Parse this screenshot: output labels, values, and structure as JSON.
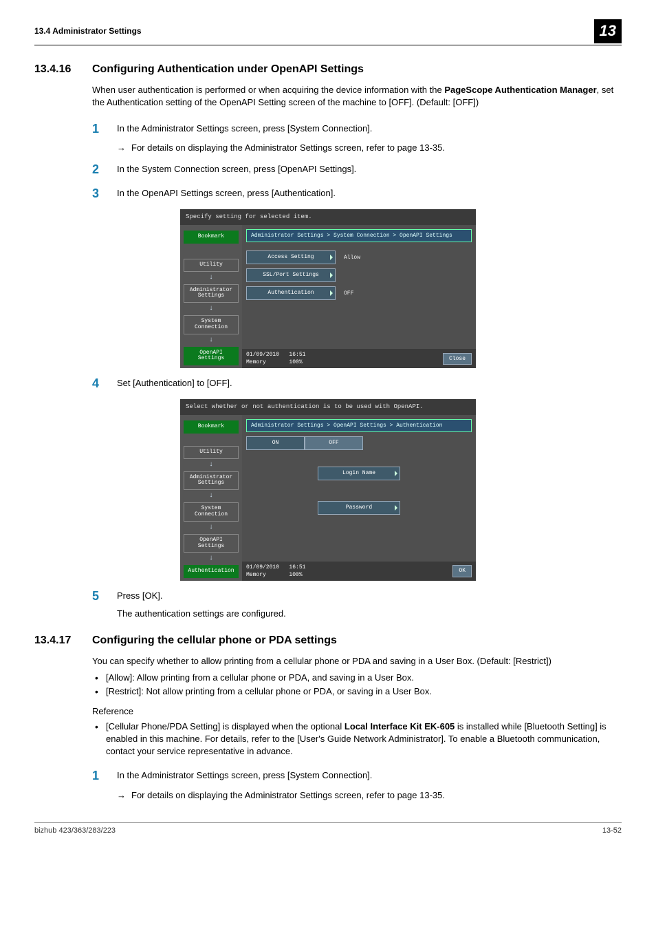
{
  "header": {
    "left": "13.4    Administrator Settings",
    "right": "13"
  },
  "sec1": {
    "num": "13.4.16",
    "title": "Configuring Authentication under OpenAPI Settings",
    "intro_a": "When user authentication is performed or when acquiring the device information with the ",
    "intro_bold": "PageScope Authentication Manager",
    "intro_b": ", set the Authentication setting of the OpenAPI Setting screen of the machine to [OFF]. (Default: [OFF])",
    "steps": {
      "s1": "In the Administrator Settings screen, press [System Connection].",
      "s1_sub": "For details on displaying the Administrator Settings screen, refer to page 13-35.",
      "s2": "In the System Connection screen, press [OpenAPI Settings].",
      "s3": "In the OpenAPI Settings screen, press [Authentication].",
      "s4": "Set [Authentication] to [OFF].",
      "s5": "Press [OK].",
      "s5_after": "The authentication settings are configured."
    }
  },
  "screen1": {
    "top": "Specify setting for selected item.",
    "crumb": "Administrator Settings > System Connection > OpenAPI Settings",
    "side": {
      "bookmark": "Bookmark",
      "utility": "Utility",
      "admin": "Administrator\nSettings",
      "sys": "System\nConnection",
      "open": "OpenAPI\nSettings"
    },
    "rows": {
      "r1_label": "Access Setting",
      "r1_val": "Allow",
      "r2_label": "SSL/Port Settings",
      "r3_label": "Authentication",
      "r3_val": "OFF"
    },
    "dt_date": "01/09/2010",
    "dt_time": "16:51",
    "mem_label": "Memory",
    "mem_val": "100%",
    "close": "Close"
  },
  "screen2": {
    "top": "Select whether or not authentication is to be used with OpenAPI.",
    "crumb": "Administrator Settings > OpenAPI Settings > Authentication",
    "side": {
      "bookmark": "Bookmark",
      "utility": "Utility",
      "admin": "Administrator\nSettings",
      "sys": "System\nConnection",
      "open": "OpenAPI\nSettings",
      "auth": "Authentication"
    },
    "on": "ON",
    "off": "OFF",
    "login": "Login Name",
    "password": "Password",
    "dt_date": "01/09/2010",
    "dt_time": "16:51",
    "mem_label": "Memory",
    "mem_val": "100%",
    "ok": "OK"
  },
  "sec2": {
    "num": "13.4.17",
    "title": "Configuring the cellular phone or PDA settings",
    "intro": "You can specify whether to allow printing from a cellular phone or PDA and saving in a User Box. (Default: [Restrict])",
    "b1": "[Allow]: Allow printing from a cellular phone or PDA, and saving in a User Box.",
    "b2": "[Restrict]: Not allow printing from a cellular phone or PDA, or saving in a User Box.",
    "ref_label": "Reference",
    "ref1_a": "[Cellular Phone/PDA Setting] is displayed when the optional ",
    "ref1_bold": "Local Interface Kit EK-605",
    "ref1_b": " is installed while [Bluetooth Setting] is enabled in this machine. For details, refer to the [User's Guide Network Administrator]. To enable a Bluetooth communication, contact your service representative in advance.",
    "step1": "In the Administrator Settings screen, press [System Connection].",
    "step1_sub": "For details on displaying the Administrator Settings screen, refer to page 13-35."
  },
  "footer": {
    "left": "bizhub 423/363/283/223",
    "right": "13-52"
  }
}
